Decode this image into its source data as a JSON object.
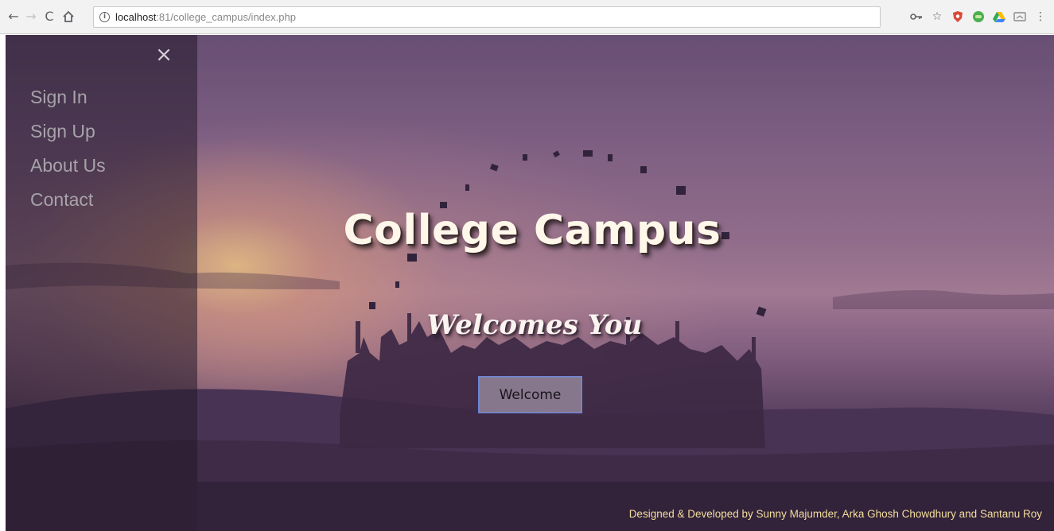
{
  "browser": {
    "url_host": "localhost",
    "url_rest": ":81/college_campus/index.php",
    "icons": [
      "back-arrow-icon",
      "forward-arrow-icon",
      "reload-icon",
      "home-icon",
      "info-icon",
      "key-icon",
      "star-icon",
      "shield-extension-icon",
      "green-extension-icon",
      "drive-icon",
      "cast-icon",
      "menu-dots-icon"
    ]
  },
  "side_nav": {
    "close_symbol": "×",
    "items": [
      {
        "label": "Sign In"
      },
      {
        "label": "Sign Up"
      },
      {
        "label": "About Us"
      },
      {
        "label": "Contact"
      }
    ]
  },
  "hero": {
    "title": "College Campus",
    "subtitle": "Welcomes You",
    "button_label": "Welcome"
  },
  "footer": {
    "credits": "Designed & Developed by Sunny Majumder, Arka Ghosh Chowdhury and Santanu Roy"
  },
  "colors": {
    "footer_text": "#f3df9c",
    "button_border": "#6c85d6",
    "nav_text": "#a7a3aa"
  }
}
